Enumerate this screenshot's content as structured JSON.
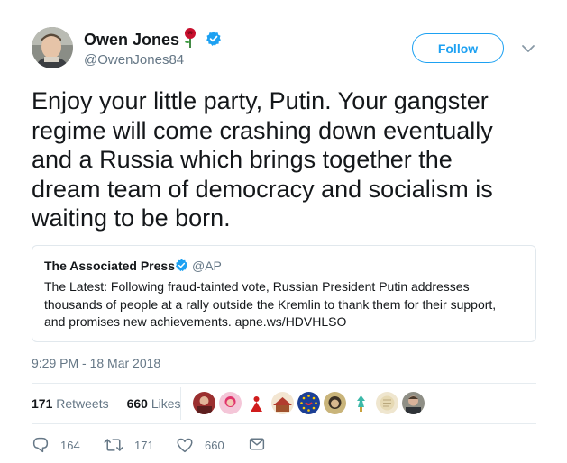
{
  "author": {
    "name": "Owen Jones",
    "handle": "@OwenJones84",
    "rose_icon": "rose-icon",
    "verified_icon": "verified-badge-icon"
  },
  "follow_label": "Follow",
  "tweet_text": "Enjoy your little party, Putin. Your gangster\nregime will come crashing down eventually\nand a Russia which brings together the\ndream team of democracy and socialism is\nwaiting to be born.",
  "quote": {
    "name": "The Associated Press",
    "handle": "@AP",
    "text": "The Latest: Following fraud-tainted vote, Russian President Putin addresses\nthousands of people at a rally outside the Kremlin to thank them for their support,\nand promises new achievements. apne.ws/HDVHLSO"
  },
  "timestamp": "9:29 PM - 18 Mar 2018",
  "stats": {
    "retweets_count": "171",
    "retweets_label": "Retweets",
    "likes_count": "660",
    "likes_label": "Likes"
  },
  "actions": {
    "reply_count": "164",
    "retweet_count": "171",
    "like_count": "660"
  },
  "colors": {
    "accent": "#1da1f2",
    "text": "#14171a",
    "muted": "#657786",
    "border": "#e1e8ed"
  }
}
